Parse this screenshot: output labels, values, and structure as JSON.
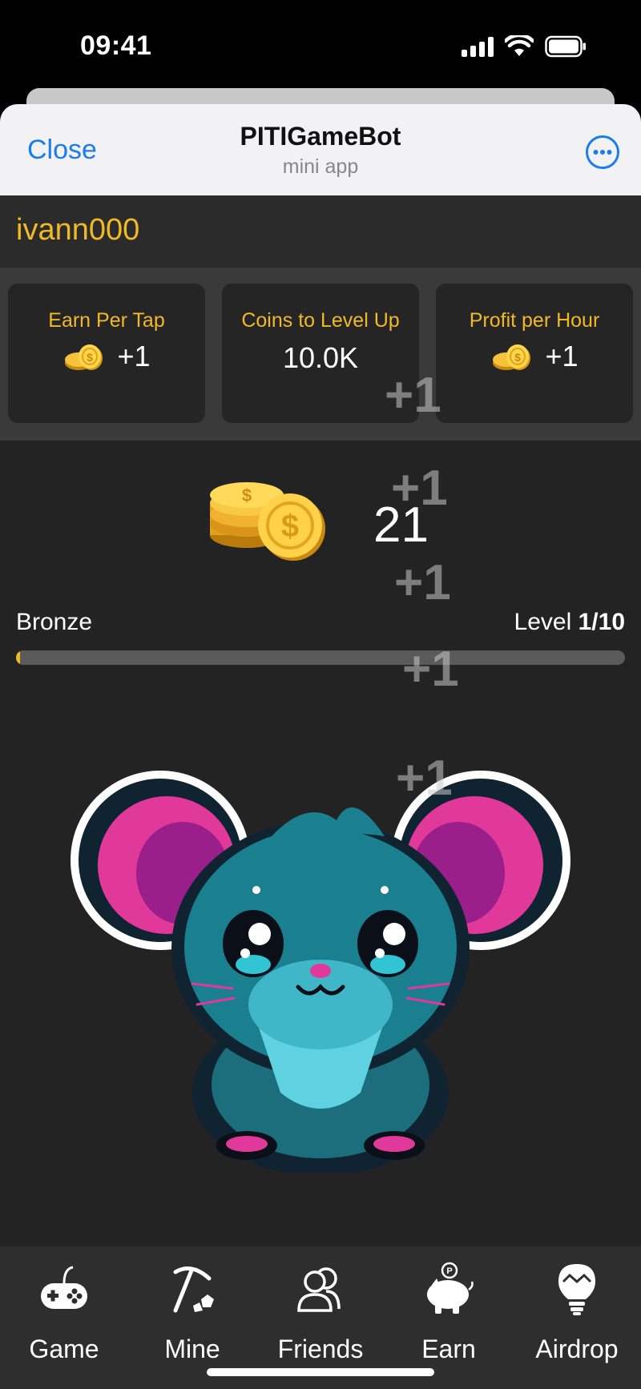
{
  "status_bar": {
    "time": "09:41"
  },
  "header": {
    "close_label": "Close",
    "title": "PITIGameBot",
    "subtitle": "mini app"
  },
  "user": {
    "username": "ivann000"
  },
  "stats": [
    {
      "label": "Earn Per Tap",
      "value": "+1",
      "icon": "coin-icon"
    },
    {
      "label": "Coins to Level Up",
      "value": "10.0K"
    },
    {
      "label": "Profit per Hour",
      "value": "+1",
      "icon": "coin-icon"
    }
  ],
  "balance": {
    "value": "21",
    "icon": "coin-stack-icon"
  },
  "level": {
    "rank": "Bronze",
    "prefix": "Level ",
    "value": "1/10",
    "progress_fraction": 0.005
  },
  "floating_taps": [
    "+1",
    "+1",
    "+1",
    "+1",
    "+1"
  ],
  "mascot": {
    "name": "mouse-mascot"
  },
  "nav": [
    {
      "label": "Game",
      "icon": "gamepad-icon"
    },
    {
      "label": "Mine",
      "icon": "pickaxe-icon"
    },
    {
      "label": "Friends",
      "icon": "friends-icon"
    },
    {
      "label": "Earn",
      "icon": "piggy-bank-icon"
    },
    {
      "label": "Airdrop",
      "icon": "lightbulb-icon"
    }
  ],
  "colors": {
    "accent": "#f0b928",
    "link": "#1a7cf0",
    "background": "#232323"
  }
}
